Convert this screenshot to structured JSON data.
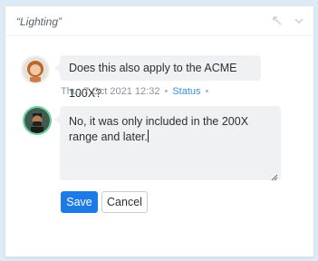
{
  "header": {
    "title": "“Lighting”"
  },
  "header_icons": [
    "collapse-icon",
    "chevron-down-icon"
  ],
  "comment": {
    "text": "Does this also apply to the ACME 100X?",
    "timestamp": "Thu, 7 Oct 2021 12:32",
    "status_label": "Status",
    "separator": "•"
  },
  "reply": {
    "text": "No, it was only included in the 200X range and later."
  },
  "actions": {
    "save_label": "Save",
    "cancel_label": "Cancel"
  },
  "colors": {
    "accent": "#1e7ae6",
    "link": "#3a8fd6",
    "avatar_ring": "#6bd39b"
  }
}
